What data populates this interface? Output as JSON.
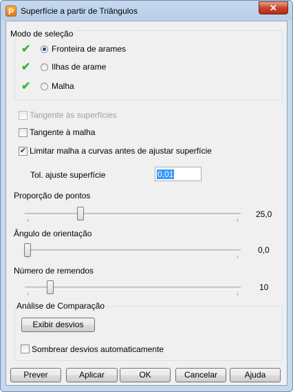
{
  "window": {
    "title": "Superfície a partir de Triângulos",
    "icon_letter": "P",
    "close_glyph": "✕"
  },
  "selection_mode": {
    "label": "Modo de seleção",
    "options": [
      {
        "label": "Fronteira de arames",
        "selected": true,
        "check": "✔"
      },
      {
        "label": "Ilhas de arame",
        "selected": false,
        "check": "✔"
      },
      {
        "label": "Malha",
        "selected": false,
        "check": "✔"
      }
    ]
  },
  "options": {
    "tangent_surfaces": {
      "label": "Tangente às superfícies",
      "checked": false,
      "enabled": false
    },
    "tangent_mesh": {
      "label": "Tangente à malha",
      "checked": false
    },
    "limit_mesh": {
      "label": "Limitar malha a curvas antes de ajustar superfície",
      "checked": true,
      "mark": "✔"
    }
  },
  "tolerance": {
    "label": "Tol. ajuste superfície",
    "value": "0,01"
  },
  "sliders": {
    "point_ratio": {
      "label": "Proporção de pontos",
      "value_text": "25,0",
      "fraction": 0.27
    },
    "orientation_angle": {
      "label": "Ângulo de orientação",
      "value_text": "0,0",
      "fraction": 0.0
    },
    "patch_count": {
      "label": "Número de remendos",
      "value_text": "10",
      "fraction": 0.12
    }
  },
  "comparison": {
    "label": "Análise de Comparação",
    "show_deviations_button": "Exibir desvios",
    "auto_shade": {
      "label": "Sombrear desvios automaticamente",
      "checked": false
    }
  },
  "footer_buttons": {
    "preview": "Prever",
    "apply": "Aplicar",
    "ok": "OK",
    "cancel": "Cancelar",
    "help": "Ajuda"
  },
  "colors": {
    "check_green": "#3db43a",
    "selection_blue": "#3399ff",
    "close_red": "#c8452d"
  },
  "icons": [
    "app-icon",
    "close-icon",
    "green-check-icon",
    "checkbox-check-icon"
  ]
}
